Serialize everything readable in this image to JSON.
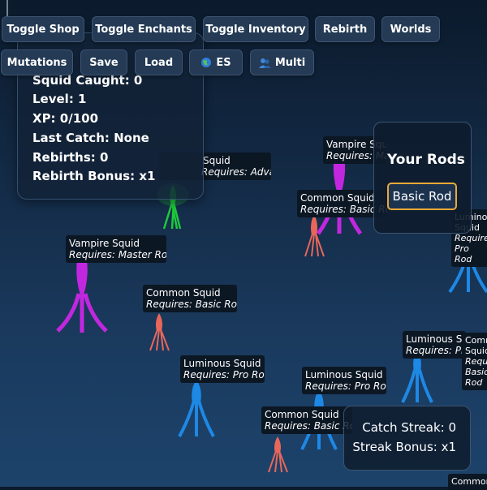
{
  "toolbar": {
    "row1": [
      "Toggle Shop",
      "Toggle Enchants",
      "Toggle Inventory",
      "Rebirth",
      "Worlds"
    ],
    "row2": [
      "Mutations",
      "Save",
      "Load",
      "ES",
      "Multi"
    ],
    "lang_icon": "globe-icon",
    "multi_icon": "players-icon"
  },
  "stats": {
    "squid_caught": "Squid Caught: 0",
    "level": "Level: 1",
    "xp": "XP: 0/100",
    "last_catch": "Last Catch: None",
    "rebirths": "Rebirths: 0",
    "rebirth_bonus": "Rebirth Bonus: x1"
  },
  "rods": {
    "title": "Your Rods",
    "items": [
      "Basic Rod"
    ],
    "highlight_color": "#e8a93a"
  },
  "streak": {
    "catch_streak": "Catch Streak: 0",
    "streak_bonus": "Streak Bonus: x1"
  },
  "squids": [
    {
      "name": "Vampire Squid",
      "requires": "Requires: Master Rod",
      "color": "#c227e0"
    },
    {
      "name": "Common Squid",
      "requires": "Requires: Basic Rod",
      "color": "#e8675a"
    },
    {
      "name": "Luminous Squid",
      "requires": "Requires: Pro Rod",
      "color": "#1e88e5"
    },
    {
      "name": "Luminous Squid",
      "requires": "Requires: Pro Rod",
      "color": "#1e88e5"
    },
    {
      "name": "Common Squid",
      "requires": "Requires: Basic Rod",
      "color": "#e8675a"
    },
    {
      "name": "Vampire Squid",
      "requires": "Requires: Master Rod",
      "color": "#c227e0"
    },
    {
      "name": "Common Squid",
      "requires": "Requires: Basic Rod",
      "color": "#e8675a"
    },
    {
      "name": "Squid",
      "requires": "Requires: Advanced Rod",
      "color": "#1ec83c"
    },
    {
      "name": "Luminous Squid",
      "requires": "Requires: Pro Rod",
      "color": "#1e88e5"
    },
    {
      "name": "Luminous Squid",
      "requires": "Requires: Pro Rod",
      "color": "#1e88e5"
    },
    {
      "name": "Common Squid",
      "requires": "Requires: Basic Rod",
      "color": "#e8675a"
    }
  ]
}
